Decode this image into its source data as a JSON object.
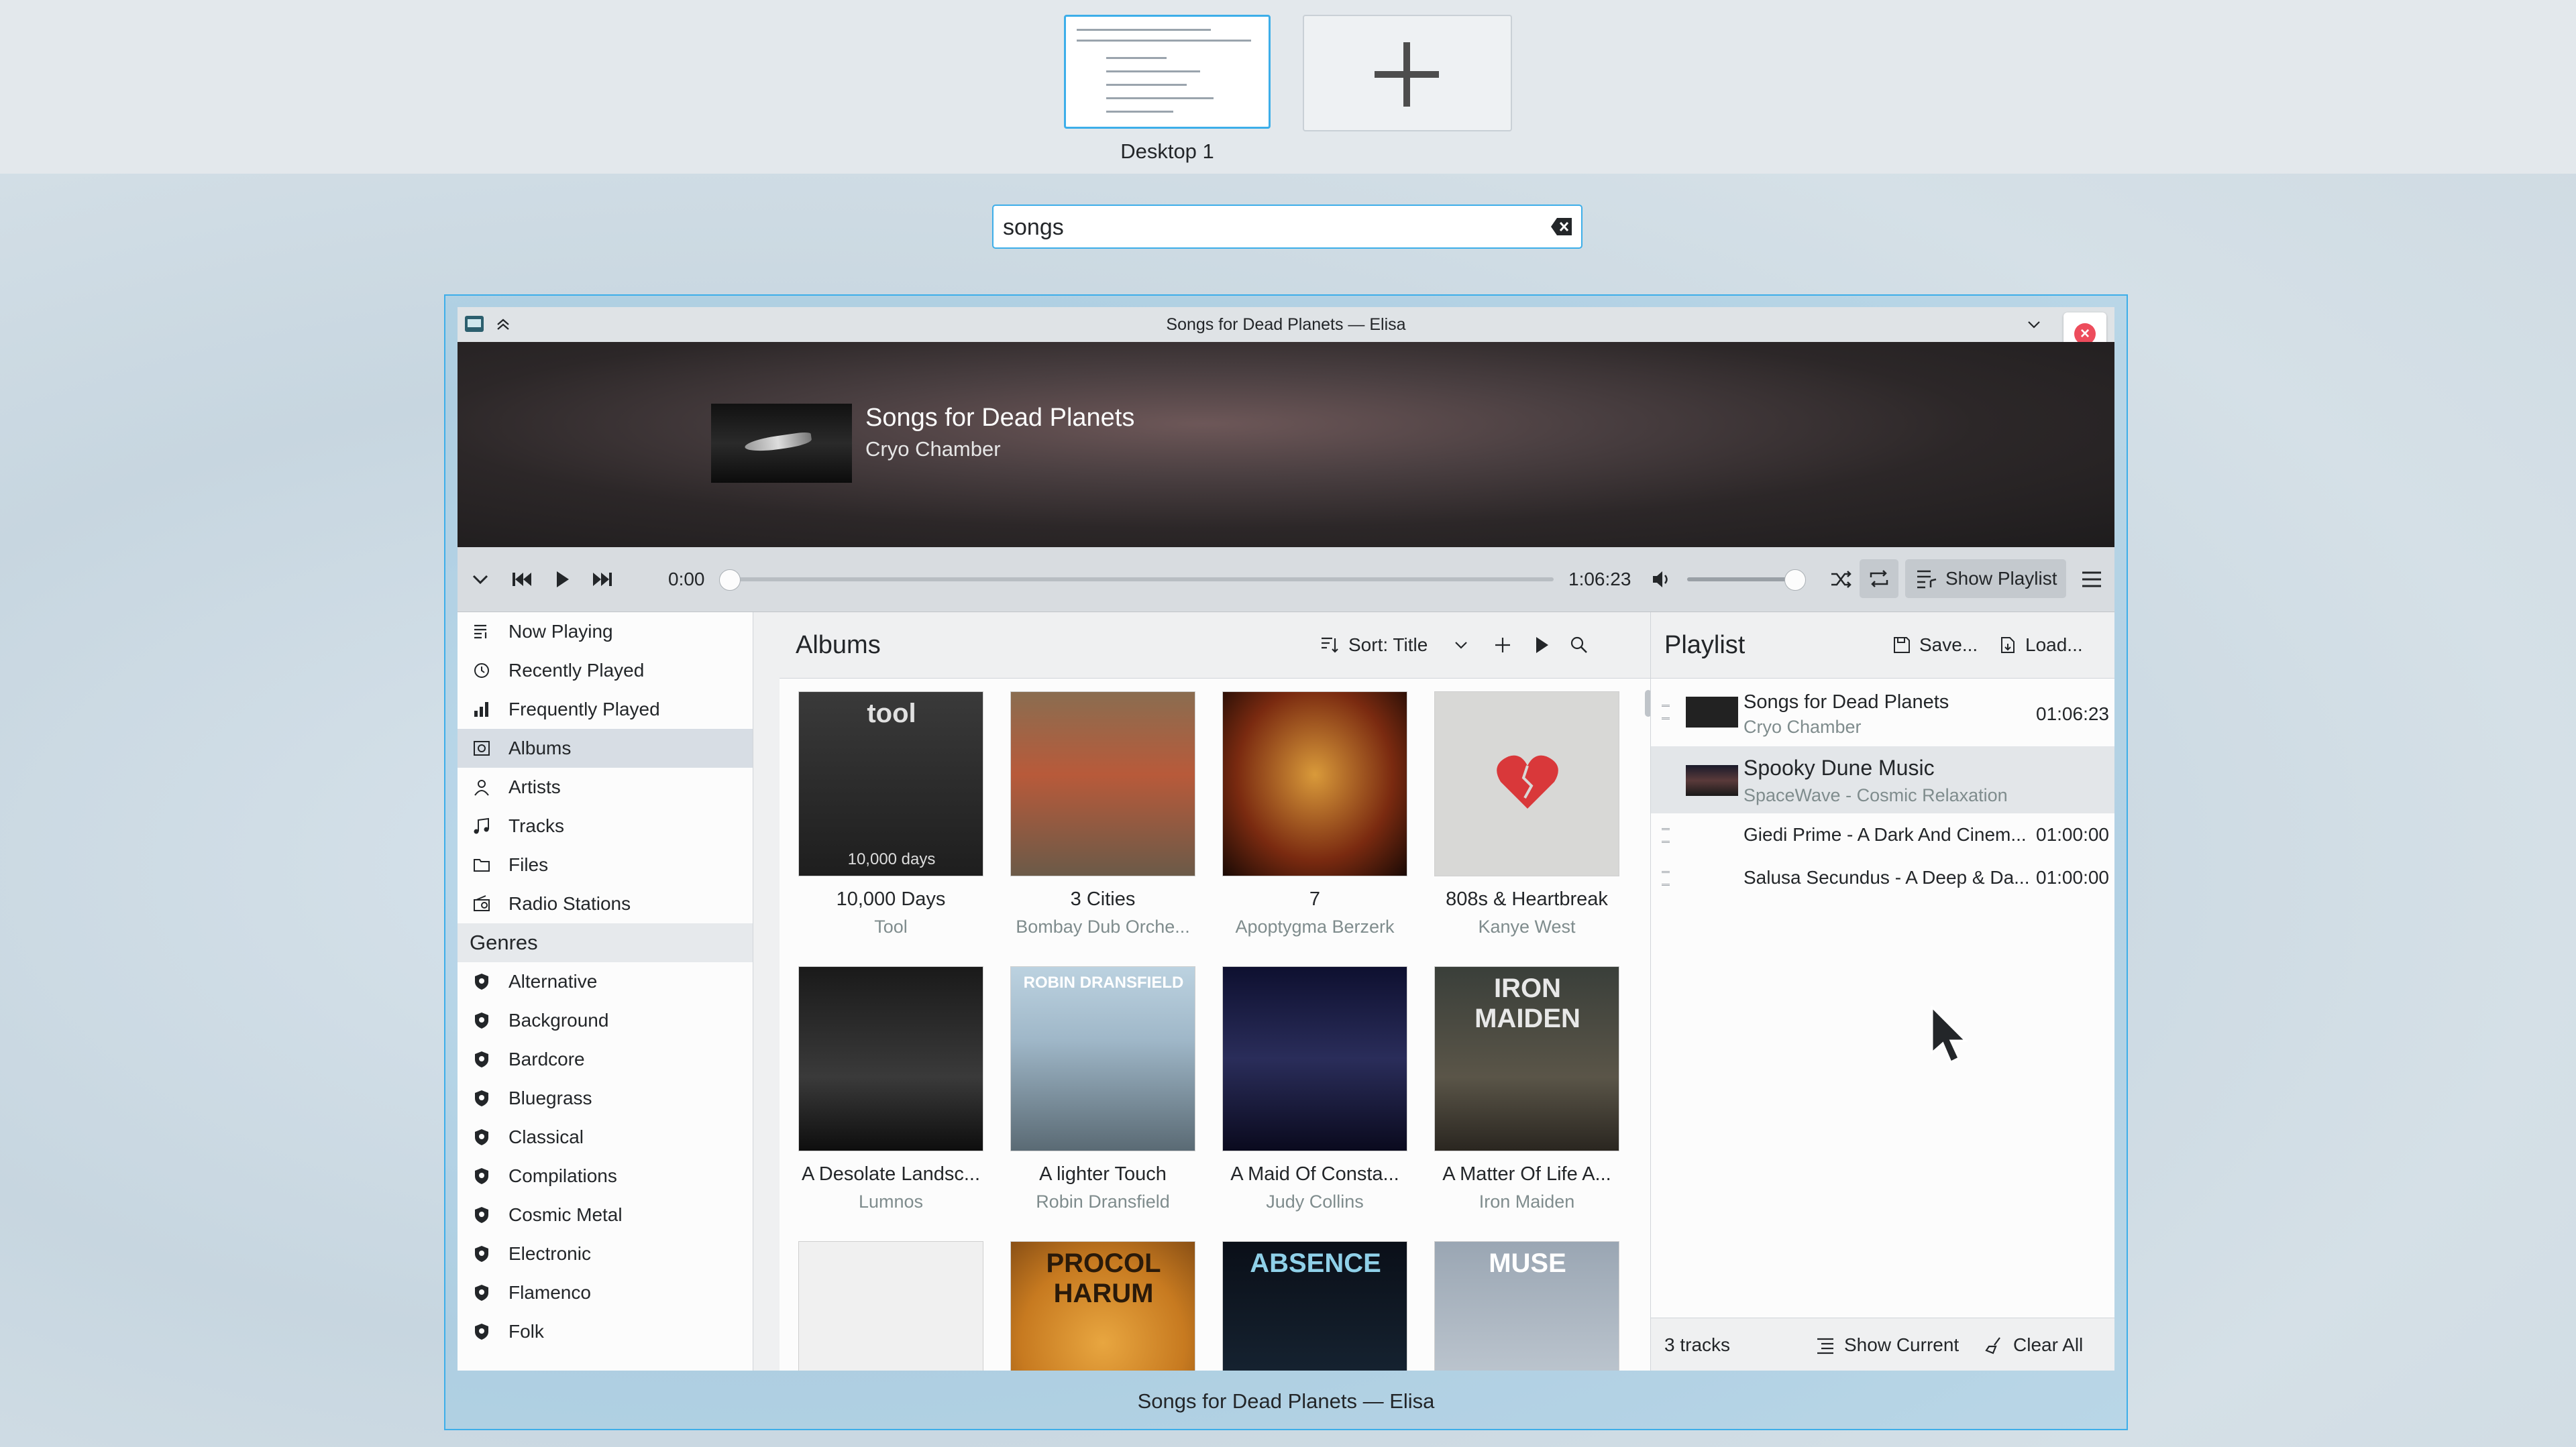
{
  "desktop": {
    "label": "Desktop 1",
    "add_label": "+"
  },
  "search": {
    "value": "songs"
  },
  "window": {
    "title": "Songs for Dead Planets — Elisa",
    "caption": "Songs for Dead Planets — Elisa"
  },
  "header": {
    "title": "Songs for Dead Planets",
    "artist": "Cryo Chamber"
  },
  "playback": {
    "time_current": "0:00",
    "time_total": "1:06:23",
    "progress": 0,
    "volume": 1.0,
    "show_playlist_label": "Show Playlist"
  },
  "sidebar": {
    "items": [
      {
        "label": "Now Playing",
        "icon": "now-playing-icon"
      },
      {
        "label": "Recently Played",
        "icon": "clock-icon"
      },
      {
        "label": "Frequently Played",
        "icon": "bar-chart-icon"
      },
      {
        "label": "Albums",
        "icon": "album-icon"
      },
      {
        "label": "Artists",
        "icon": "person-icon"
      },
      {
        "label": "Tracks",
        "icon": "music-note-icon"
      },
      {
        "label": "Files",
        "icon": "folder-icon"
      },
      {
        "label": "Radio Stations",
        "icon": "radio-icon"
      }
    ],
    "genres_label": "Genres",
    "genres": [
      "Alternative",
      "Background",
      "Bardcore",
      "Bluegrass",
      "Classical",
      "Compilations",
      "Cosmic Metal",
      "Electronic",
      "Flamenco",
      "Folk"
    ]
  },
  "albums": {
    "title": "Albums",
    "sort_label": "Sort: Title",
    "items": [
      {
        "title": "10,000 Days",
        "artist": "Tool"
      },
      {
        "title": "3 Cities",
        "artist": "Bombay Dub Orche..."
      },
      {
        "title": "7",
        "artist": "Apoptygma Berzerk"
      },
      {
        "title": "808s & Heartbreak",
        "artist": "Kanye West"
      },
      {
        "title": "A Desolate Landsc...",
        "artist": "Lumnos"
      },
      {
        "title": "A lighter Touch",
        "artist": "Robin Dransfield"
      },
      {
        "title": "A Maid Of Consta...",
        "artist": "Judy Collins"
      },
      {
        "title": "A Matter Of Life A...",
        "artist": "Iron Maiden"
      },
      {
        "title": "",
        "artist": ""
      },
      {
        "title": "",
        "artist": ""
      },
      {
        "title": "",
        "artist": ""
      },
      {
        "title": "",
        "artist": ""
      }
    ],
    "cover_text": {
      "tool": "tool",
      "tool_sub": "10,000 days",
      "robin": "ROBIN DRANSFIELD",
      "iron": "IRON MAIDEN",
      "procol": "PROCOL HARUM",
      "absence": "ABSENCE",
      "muse": "MUSE"
    }
  },
  "playlist": {
    "title": "Playlist",
    "save_label": "Save...",
    "load_label": "Load...",
    "tracks": [
      {
        "title": "Songs for Dead Planets",
        "artist": "Cryo Chamber",
        "duration": "01:06:23"
      },
      {
        "title": "Spooky Dune Music",
        "artist": "SpaceWave - Cosmic Relaxation",
        "duration": ""
      },
      {
        "title": "Giedi Prime - A Dark And Cinem...",
        "artist": "",
        "duration": "01:00:00"
      },
      {
        "title": "Salusa Secundus - A Deep & Da...",
        "artist": "",
        "duration": "01:00:00"
      }
    ],
    "count_label": "3 tracks",
    "show_current_label": "Show Current",
    "clear_all_label": "Clear All"
  },
  "colors": {
    "accent": "#3daee9",
    "close": "#ed4c5c"
  }
}
